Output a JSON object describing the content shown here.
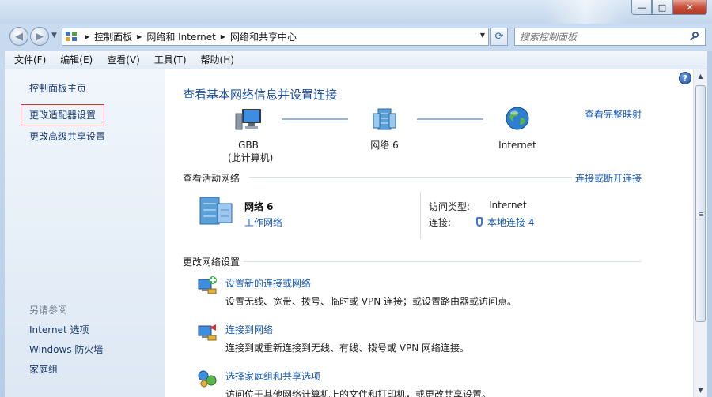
{
  "window": {
    "min_glyph": "—",
    "max_glyph": "□",
    "close_glyph": "✕"
  },
  "address_bar": {
    "crumbs": [
      "控制面板",
      "网络和 Internet",
      "网络和共享中心"
    ],
    "search_placeholder": "搜索控制面板"
  },
  "menu": {
    "items": [
      "文件(F)",
      "编辑(E)",
      "查看(V)",
      "工具(T)",
      "帮助(H)"
    ]
  },
  "sidebar": {
    "home": "控制面板主页",
    "change_adapter": "更改适配器设置",
    "change_sharing": "更改高级共享设置",
    "see_also_heading": "另请参阅",
    "see_also": [
      "Internet 选项",
      "Windows 防火墙",
      "家庭组"
    ]
  },
  "main": {
    "title": "查看基本网络信息并设置连接",
    "full_map_link": "查看完整映射",
    "nodes": {
      "computer_name": "GBB",
      "computer_sub": "(此计算机)",
      "network": "网络  6",
      "internet": "Internet"
    },
    "active_networks": {
      "heading": "查看活动网络",
      "connect_link": "连接或断开连接",
      "name": "网络  6",
      "type": "工作网络",
      "access_label": "访问类型:",
      "access_value": "Internet",
      "conn_label": "连接:",
      "conn_value": "本地连接 4"
    },
    "change_settings": {
      "heading": "更改网络设置",
      "tasks": [
        {
          "title": "设置新的连接或网络",
          "desc": "设置无线、宽带、拨号、临时或 VPN 连接；或设置路由器或访问点。"
        },
        {
          "title": "连接到网络",
          "desc": "连接到或重新连接到无线、有线、拨号或 VPN 网络连接。"
        },
        {
          "title": "选择家庭组和共享选项",
          "desc": "访问位于其他网络计算机上的文件和打印机，或更改共享设置。"
        }
      ]
    }
  },
  "colors": {
    "link": "#1a5bb5",
    "title": "#1e4fa0",
    "highlight_border": "#d93030"
  }
}
